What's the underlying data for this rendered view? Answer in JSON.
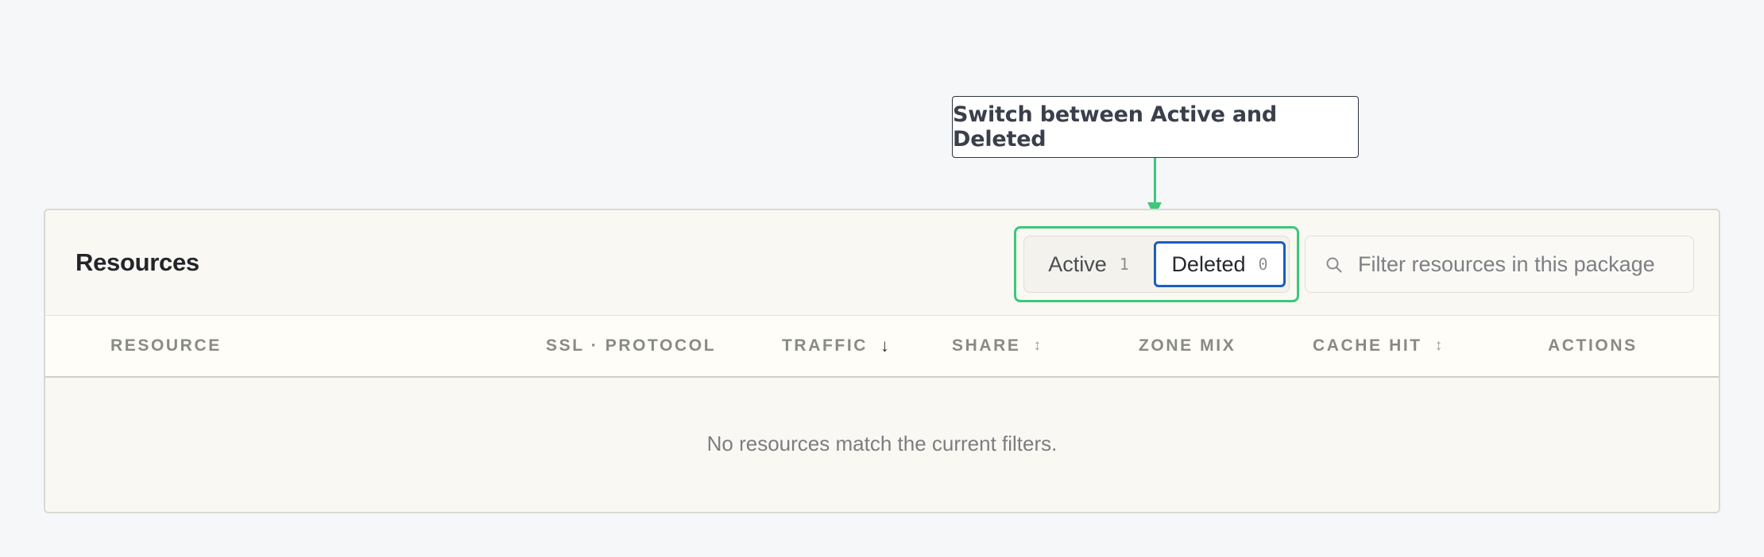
{
  "callout": {
    "text": "Switch between Active and Deleted"
  },
  "panel": {
    "title": "Resources"
  },
  "tabs": [
    {
      "label": "Active",
      "count": "1",
      "selected": false
    },
    {
      "label": "Deleted",
      "count": "0",
      "selected": true
    }
  ],
  "search": {
    "placeholder": "Filter resources in this package",
    "value": "",
    "icon": "search-icon"
  },
  "table": {
    "columns": [
      {
        "label": "RESOURCE",
        "sort": ""
      },
      {
        "label": "SSL · PROTOCOL",
        "sort": ""
      },
      {
        "label": "TRAFFIC",
        "sort": "↓"
      },
      {
        "label": "SHARE",
        "sort": "↕"
      },
      {
        "label": "ZONE MIX",
        "sort": ""
      },
      {
        "label": "CACHE HIT",
        "sort": "↕"
      },
      {
        "label": "ACTIONS",
        "sort": ""
      }
    ],
    "rows": [],
    "empty_message": "No resources match the current filters."
  },
  "colors": {
    "highlight": "#3dc77a",
    "selected_tab_border": "#1a5dc2",
    "panel_bg": "#faf8f3",
    "page_bg": "#f6f7f9"
  }
}
